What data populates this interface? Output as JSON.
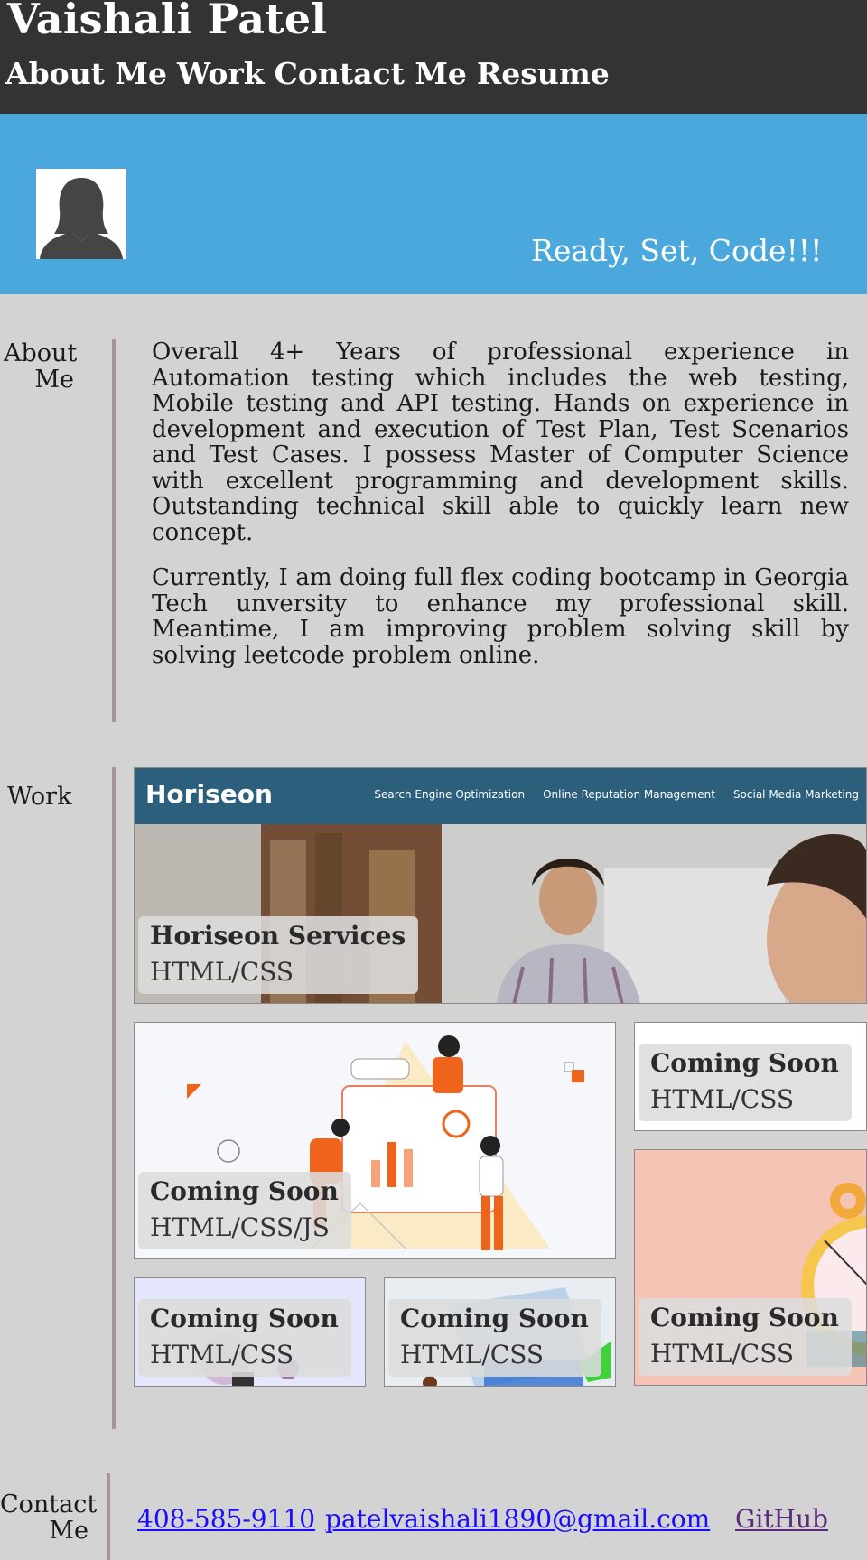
{
  "header": {
    "title": "Vaishali Patel",
    "nav": [
      "About Me",
      "Work",
      "Contact Me",
      "Resume"
    ]
  },
  "hero": {
    "tagline": "Ready, Set, Code!!!"
  },
  "about": {
    "label_line1": "About",
    "label_line2": "Me",
    "paragraphs": [
      "Overall 4+ Years of professional experience in Automation testing which includes the web testing, Mobile testing and API testing. Hands on experience in development and execution of Test Plan, Test Scenarios and Test Cases. I possess Master of Computer Science with excellent programming and development skills. Outstanding technical skill able to quickly learn new concept.",
      "Currently, I am doing full flex coding bootcamp in Georgia Tech unversity to enhance my professional skill. Meantime, I am improving problem solving skill by solving leetcode problem online."
    ]
  },
  "work": {
    "label": "Work",
    "horiseon_logo": "Horiseon",
    "horiseon_links": [
      "Search Engine Optimization",
      "Online Reputation Management",
      "Social Media Marketing"
    ],
    "projects": [
      {
        "title": "Horiseon Services",
        "tech": "HTML/CSS"
      },
      {
        "title": "Coming Soon",
        "tech": "HTML/CSS/JS"
      },
      {
        "title": "Coming Soon",
        "tech": "HTML/CSS"
      },
      {
        "title": "Coming Soon",
        "tech": "HTML/CSS"
      },
      {
        "title": "Coming Soon",
        "tech": "HTML/CSS"
      },
      {
        "title": "Coming Soon",
        "tech": "HTML/CSS"
      }
    ]
  },
  "contact": {
    "label_line1": "Contact",
    "label_line2": "Me",
    "phone": "408-585-9110",
    "email": "patelvaishali1890@gmail.com",
    "github": "GitHub"
  },
  "colors": {
    "header_bg": "#333333",
    "hero_bg": "#4aa8dd",
    "page_bg": "#d3d3d3",
    "divider": "#a89598"
  }
}
